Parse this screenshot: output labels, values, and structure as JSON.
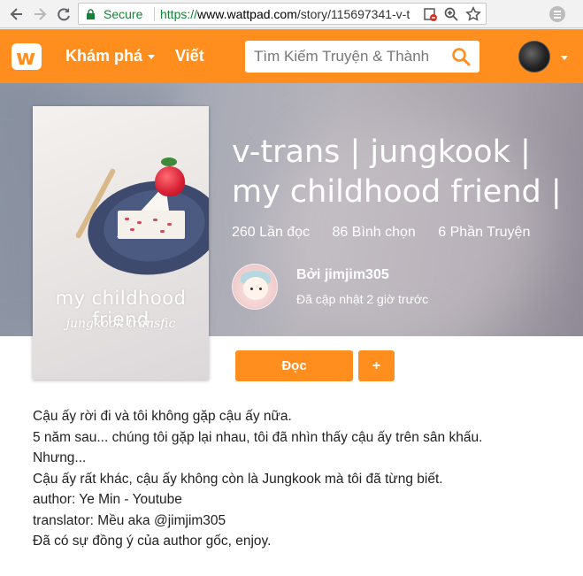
{
  "browser": {
    "secure_label": "Secure",
    "url_scheme": "https://",
    "url_host": "www.wattpad.com",
    "url_path": "/story/115697341-v-t"
  },
  "header": {
    "logo_glyph": "w",
    "discover_label": "Khám phá",
    "write_label": "Viết",
    "search_placeholder": "Tìm Kiếm Truyện & Thành",
    "brand_color": "#ff8e1e"
  },
  "cover": {
    "title": "my childhood friend",
    "subtitle": "jungkook transfic"
  },
  "story": {
    "title_line1": "v-trans | jungkook |",
    "title_line2": "my childhood friend |",
    "reads": "260 Lần đọc",
    "votes": "86 Bình chọn",
    "parts": "6 Phần Truyện",
    "author": "Bởi jimjim305",
    "updated": "Đã cập nhật 2 giờ trước"
  },
  "actions": {
    "read_label": "Đọc",
    "add_label": "+"
  },
  "description": [
    "Cậu ấy rời đi và tôi không gặp cậu ấy nữa.",
    "5 năm sau... chúng tôi gặp lại nhau, tôi đã nhìn thấy cậu ấy trên sân khấu.",
    "Nhưng...",
    "Cậu ấy rất khác, cậu ấy không còn là Jungkook mà tôi đã từng biết.",
    "author: Ye Min - Youtube",
    "translator: Mều aka @jimjim305",
    "Đã có sự đồng ý của author gốc, enjoy."
  ]
}
